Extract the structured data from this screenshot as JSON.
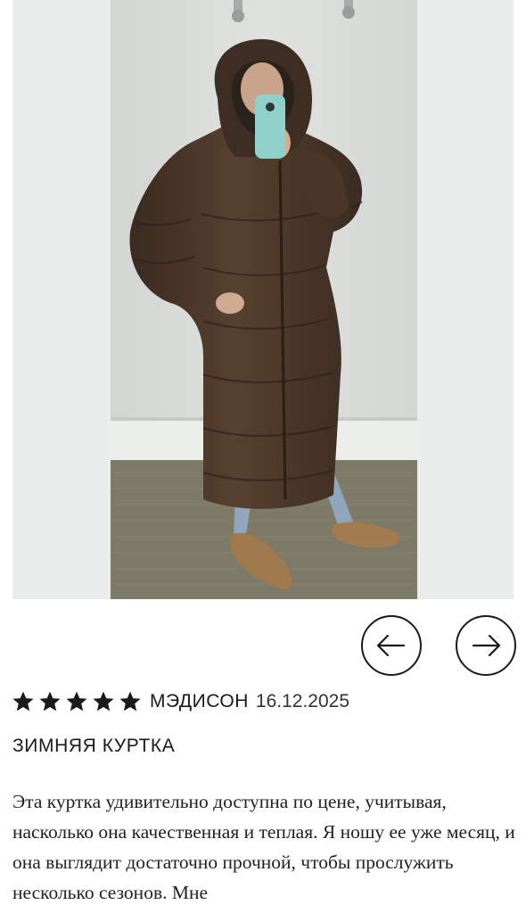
{
  "review": {
    "rating": 5,
    "max_rating": 5,
    "author": "МЭДИСОН",
    "date": "16.12.2025",
    "title": "ЗИМНЯЯ КУРТКА",
    "body": "Эта куртка удивительно доступна по цене, учитывая, насколько она качественная и теплая. Я ношу ее уже месяц, и она выглядит достаточно прочной, чтобы прослужить несколько сезонов. Мне"
  },
  "navigation": {
    "prev_icon": "arrow-left-icon",
    "next_icon": "arrow-right-icon"
  },
  "colors": {
    "coat": "#4a3528",
    "wall": "#dadcd9",
    "carpet": "#7d7a68",
    "star": "#1a1a1a"
  }
}
